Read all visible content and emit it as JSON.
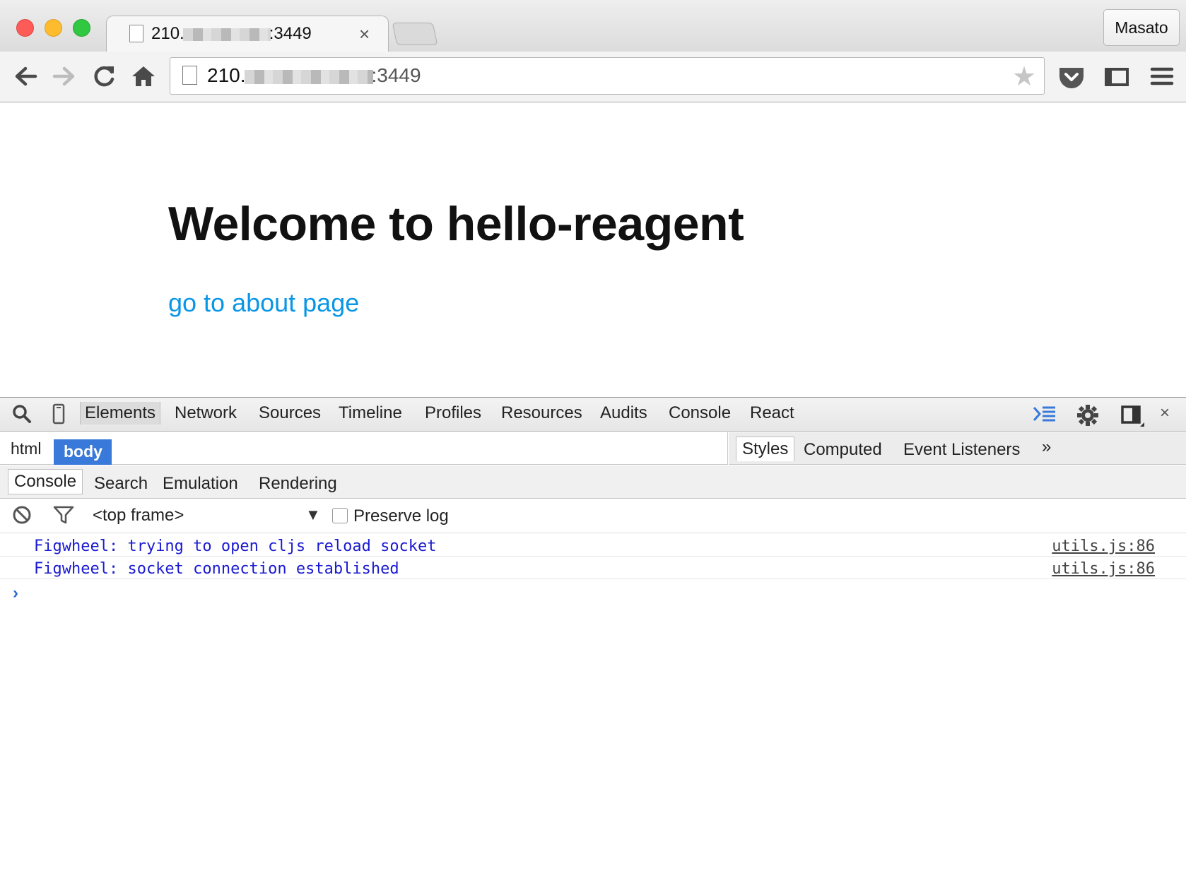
{
  "browser": {
    "tab": {
      "title_prefix": "210.",
      "title_suffix": ":3449",
      "close_glyph": "×"
    },
    "profile_name": "Masato",
    "address_bar": {
      "url_prefix": "210.",
      "url_suffix": ":3449"
    },
    "toolbar_icons": [
      "back-icon",
      "forward-icon",
      "reload-icon",
      "home-icon",
      "bookmark-star-icon",
      "pocket-icon",
      "cast-icon",
      "menu-icon"
    ]
  },
  "page": {
    "heading": "Welcome to hello-reagent",
    "link": "go to about page",
    "link_color": "#0a96e6"
  },
  "devtools": {
    "tabs": [
      "Elements",
      "Network",
      "Sources",
      "Timeline",
      "Profiles",
      "Resources",
      "Audits",
      "Console",
      "React"
    ],
    "selected_tab": "Elements",
    "breadcrumbs": [
      "html",
      "body"
    ],
    "selected_breadcrumb": "body",
    "sidebar_tabs": [
      "Styles",
      "Computed",
      "Event Listeners"
    ],
    "sidebar_more": "»",
    "drawer_tabs": [
      "Console",
      "Search",
      "Emulation",
      "Rendering"
    ],
    "console": {
      "frame_select": "<top frame>",
      "preserve_log_label": "Preserve log",
      "preserve_log_checked": false,
      "messages": [
        {
          "text": "Figwheel: trying to open cljs reload socket",
          "source": "utils.js:86"
        },
        {
          "text": "Figwheel: socket connection established",
          "source": "utils.js:86"
        }
      ],
      "prompt_glyph": "›",
      "message_color": "#1a1ad1"
    },
    "close_glyph": "×",
    "accent": "#3879d9"
  }
}
